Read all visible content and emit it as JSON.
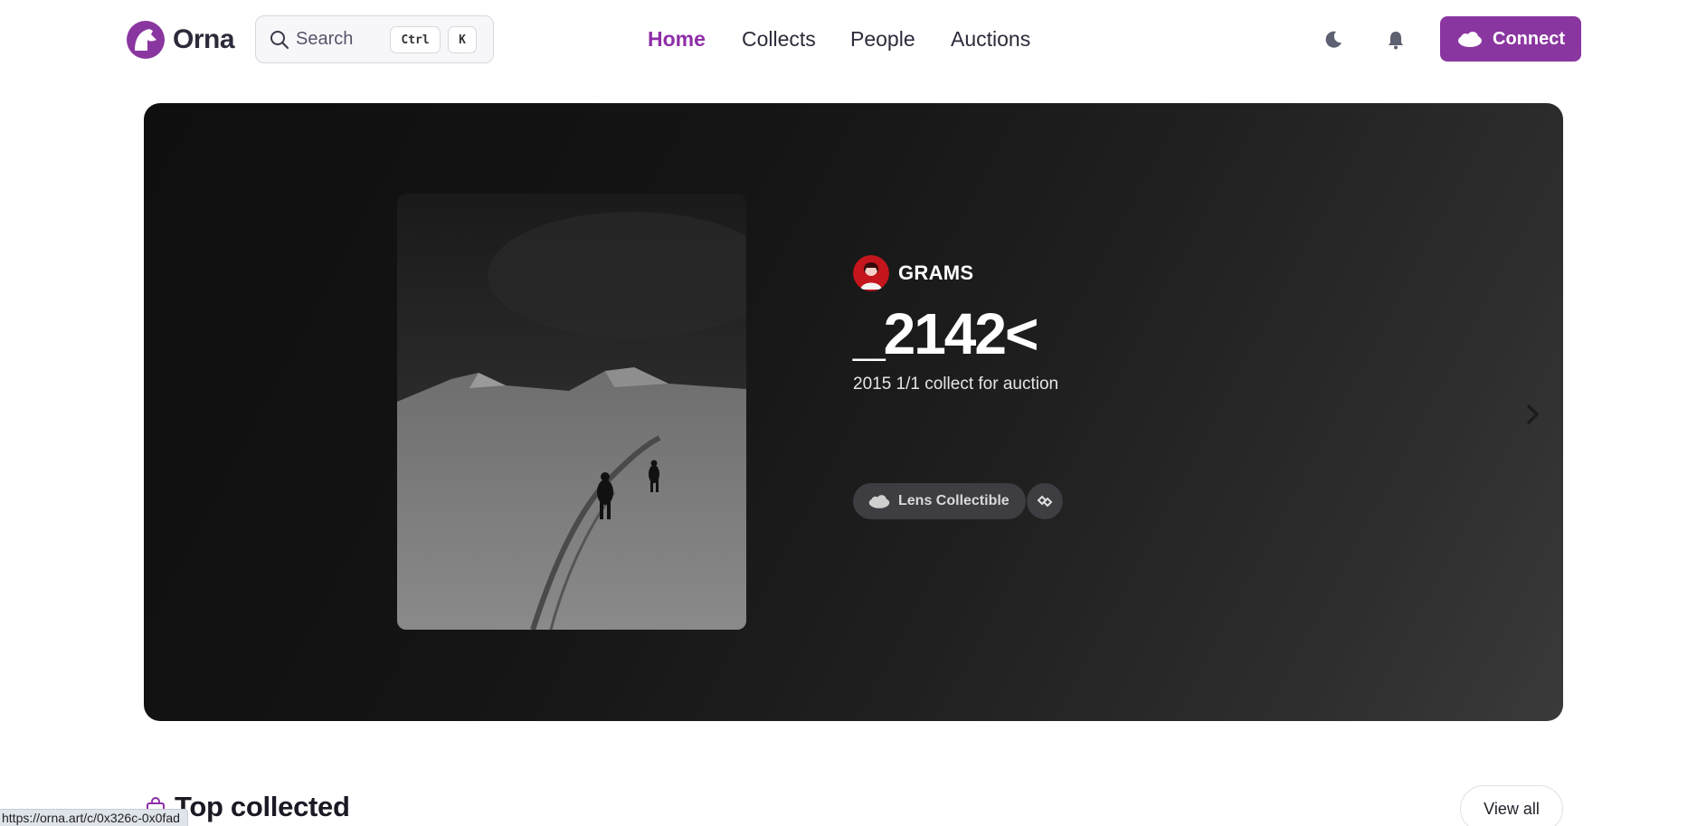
{
  "header": {
    "logo_text": "Orna",
    "search": {
      "placeholder": "Search",
      "kbd_ctrl": "Ctrl",
      "kbd_k": "K"
    },
    "nav": [
      {
        "label": "Home",
        "active": true
      },
      {
        "label": "Collects",
        "active": false
      },
      {
        "label": "People",
        "active": false
      },
      {
        "label": "Auctions",
        "active": false
      }
    ],
    "theme_icon": "moon-icon",
    "notification_icon": "bell-icon",
    "connect_label": "Connect"
  },
  "hero": {
    "creator": "GRAMS",
    "title": "_2142<",
    "subtitle": "2015 1/1 collect for auction",
    "tag_label": "Lens Collectible",
    "chain_icon": "chain-link-icon",
    "next_icon": "chevron-right-icon"
  },
  "section": {
    "title": "Top collected",
    "view_all_label": "View all"
  },
  "status_url": "https://orna.art/c/0x326c-0x0fad",
  "colors": {
    "accent": "#8e2ea8",
    "connect_bg": "#8a36a0"
  }
}
